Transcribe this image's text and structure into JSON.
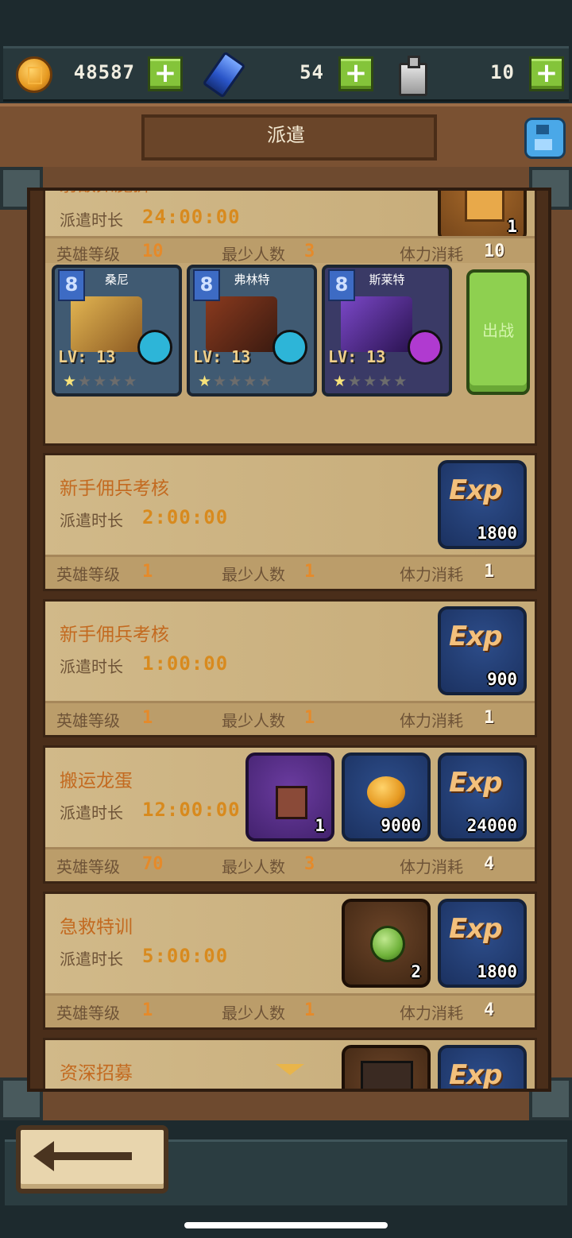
{
  "resources": {
    "gold": {
      "icon": "gold-coin-icon",
      "value": "48587"
    },
    "gems": {
      "icon": "blue-gem-icon",
      "value": "54"
    },
    "stamina": {
      "icon": "potion-bottle-icon",
      "value": "10"
    },
    "plus_label": "+"
  },
  "header": {
    "title": "派遣",
    "menu_icon": "floppy-disk-icon"
  },
  "labels": {
    "duration": "派遣时长",
    "hero_level": "英雄等级",
    "min_people": "最少人数",
    "stamina_cost": "体力消耗",
    "dispatch": "出战"
  },
  "missions": [
    {
      "title": "射敌如魔狮",
      "duration": "24:00:00",
      "hero_level": "10",
      "min_people": "3",
      "stamina": "10",
      "rewards": [
        {
          "kind": "scroll",
          "count": "1"
        }
      ],
      "heroes": [
        {
          "name": "桑尼",
          "level": "LV: 13",
          "stars": 1,
          "badge": "8",
          "color": "#c9a24b",
          "skill": "#2db5d8"
        },
        {
          "name": "弗林特",
          "level": "LV: 13",
          "stars": 1,
          "badge": "8",
          "color": "#7a3a22",
          "skill": "#2db5d8"
        },
        {
          "name": "斯莱特",
          "level": "LV: 13",
          "stars": 1,
          "badge": "8",
          "color": "#6a3aa8",
          "skill": "#b03ad0"
        }
      ]
    },
    {
      "title": "新手佣兵考核",
      "duration": "2:00:00",
      "hero_level": "1",
      "min_people": "1",
      "stamina": "1",
      "rewards": [
        {
          "kind": "exp",
          "count": "1800"
        }
      ]
    },
    {
      "title": "新手佣兵考核",
      "duration": "1:00:00",
      "hero_level": "1",
      "min_people": "1",
      "stamina": "1",
      "rewards": [
        {
          "kind": "exp",
          "count": "900"
        }
      ]
    },
    {
      "title": "搬运龙蛋",
      "duration": "12:00:00",
      "hero_level": "70",
      "min_people": "3",
      "stamina": "4",
      "rewards": [
        {
          "kind": "sword",
          "count": "1"
        },
        {
          "kind": "gold",
          "count": "9000"
        },
        {
          "kind": "exp",
          "count": "24000"
        }
      ]
    },
    {
      "title": "急救特训",
      "duration": "5:00:00",
      "hero_level": "1",
      "min_people": "1",
      "stamina": "4",
      "rewards": [
        {
          "kind": "potion",
          "count": "2"
        },
        {
          "kind": "exp",
          "count": "1800"
        }
      ]
    },
    {
      "title": "资深招募",
      "duration": "",
      "hero_level": "",
      "min_people": "",
      "stamina": "",
      "rewards": [
        {
          "kind": "card",
          "count": ""
        },
        {
          "kind": "exp",
          "count": ""
        }
      ]
    }
  ],
  "exp_text": "Exp",
  "star_glyph": "★"
}
